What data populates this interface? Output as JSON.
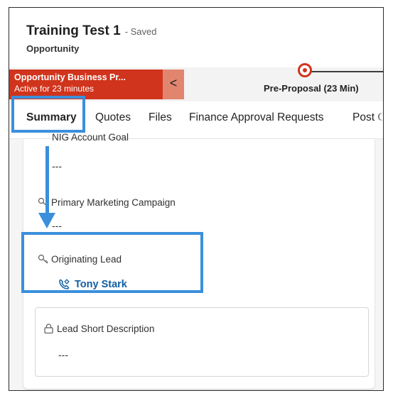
{
  "header": {
    "title": "Training Test 1",
    "saved_status": "- Saved",
    "entity": "Opportunity"
  },
  "bpf": {
    "active_name": "Opportunity Business Pr...",
    "active_time": "Active for 23 minutes",
    "collapse_glyph": "<",
    "stage_label": "Pre-Proposal  (23 Min)"
  },
  "tabs": [
    {
      "label": "Summary",
      "selected": true
    },
    {
      "label": "Quotes"
    },
    {
      "label": "Files"
    },
    {
      "label": "Finance Approval Requests"
    },
    {
      "label": "Post O"
    }
  ],
  "form": {
    "cutoff_label": "NIG Account Goal",
    "cutoff_value": "---",
    "primary_campaign_label": "Primary Marketing Campaign",
    "primary_campaign_value": "---",
    "originating_lead_label": "Originating Lead",
    "originating_lead_value": "Tony Stark",
    "lead_short_description_label": "Lead Short Description",
    "lead_short_description_value": "---"
  },
  "colors": {
    "bpf_active": "#d1341c",
    "link": "#115ea3",
    "annotation": "#3b8fdc"
  },
  "icons": [
    "key-icon",
    "lead-contact-icon",
    "lock-icon",
    "chevron-left-icon",
    "stage-target-icon"
  ]
}
